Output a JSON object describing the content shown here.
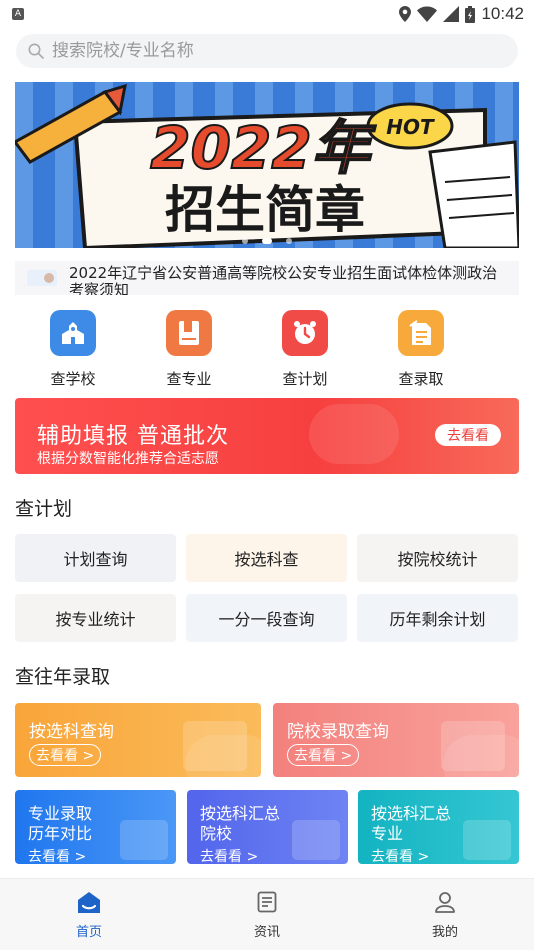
{
  "status_bar": {
    "time": "10:42"
  },
  "search": {
    "placeholder": "搜索院校/专业名称"
  },
  "banner": {
    "year_title": "2022年",
    "subtitle": "招生简章",
    "tag": "HOT",
    "slides": 3,
    "active_slide": 1
  },
  "notice": {
    "text": "2022年辽宁省公安普通高等院校公安专业招生面试体检体测政治考察须知"
  },
  "quick_menu": [
    {
      "label": "查学校",
      "icon": "school-icon",
      "color": "#3d8be6"
    },
    {
      "label": "查专业",
      "icon": "book-icon",
      "color": "#f07843"
    },
    {
      "label": "查计划",
      "icon": "alarm-clock-icon",
      "color": "#f14b48"
    },
    {
      "label": "查录取",
      "icon": "document-icon",
      "color": "#f7a93c"
    }
  ],
  "assist_banner": {
    "title": "辅助填报 普通批次",
    "subtitle": "根据分数智能化推荐合适志愿",
    "button": "去看看"
  },
  "plan_section": {
    "title": "查计划",
    "buttons": [
      {
        "label": "计划查询",
        "bg": "#f1f2f6"
      },
      {
        "label": "按选科查",
        "bg": "#fdf4ea"
      },
      {
        "label": "按院校统计",
        "bg": "#f6f3f3"
      },
      {
        "label": "按专业统计",
        "bg": "#f6f3f3"
      },
      {
        "label": "一分一段查询",
        "bg": "#f1f4f9"
      },
      {
        "label": "历年剩余计划",
        "bg": "#f1f4f9"
      }
    ]
  },
  "history_section": {
    "title": "查往年录取",
    "big_cards": [
      {
        "title": "按选科查询",
        "go": "去看看 >",
        "color": "#f7a93c"
      },
      {
        "title": "院校录取查询",
        "go": "去看看 >",
        "color": "#f58b87"
      }
    ],
    "small_cards": [
      {
        "line1": "专业录取",
        "line2": "历年对比",
        "go": "去看看 >",
        "color": "#2b82f2"
      },
      {
        "line1": "按选科汇总",
        "line2": "院校",
        "go": "去看看 >",
        "color": "#5a70ee"
      },
      {
        "line1": "按选科汇总",
        "line2": "专业",
        "go": "去看看 >",
        "color": "#20b9c6"
      }
    ]
  },
  "tabbar": {
    "tabs": [
      {
        "label": "首页",
        "icon": "home-icon",
        "active": true
      },
      {
        "label": "资讯",
        "icon": "news-icon",
        "active": false
      },
      {
        "label": "我的",
        "icon": "profile-icon",
        "active": false
      }
    ],
    "active_color": "#1e63c8"
  }
}
